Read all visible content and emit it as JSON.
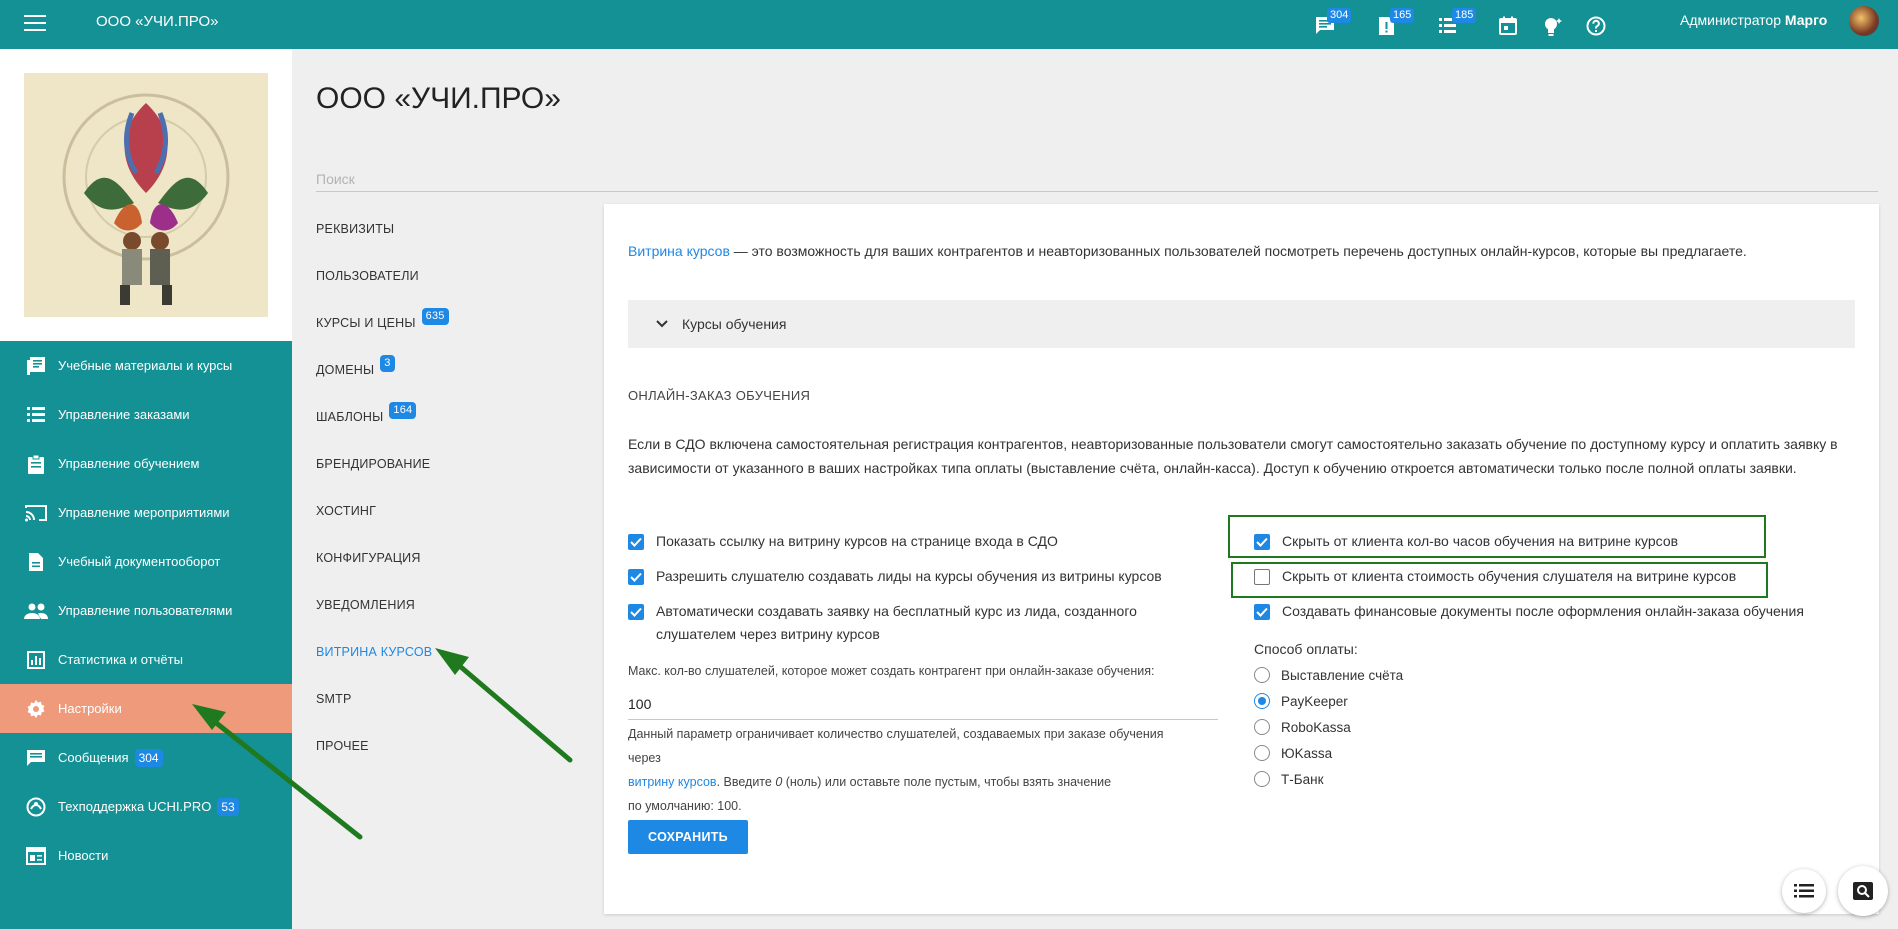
{
  "topbar": {
    "brand": "ООО «УЧИ.ПРО»",
    "badges": {
      "messages": "304",
      "docs": "165",
      "list": "185"
    },
    "admin_prefix": "Администратор",
    "admin_name": "Марго"
  },
  "sidebar": {
    "items": [
      {
        "label": "Учебные материалы и курсы",
        "icon": "book-icon"
      },
      {
        "label": "Управление заказами",
        "icon": "list-icon"
      },
      {
        "label": "Управление обучением",
        "icon": "clipboard-icon"
      },
      {
        "label": "Управление мероприятиями",
        "icon": "cast-icon"
      },
      {
        "label": "Учебный документооборот",
        "icon": "document-icon"
      },
      {
        "label": "Управление пользователями",
        "icon": "people-icon"
      },
      {
        "label": "Статистика и отчёты",
        "icon": "chart-icon"
      },
      {
        "label": "Настройки",
        "icon": "gear-icon"
      },
      {
        "label": "Сообщения",
        "icon": "message-icon",
        "badge": "304"
      },
      {
        "label": "Техподдержка UCHI.PRO",
        "icon": "support-icon",
        "badge": "53"
      },
      {
        "label": "Новости",
        "icon": "news-icon"
      }
    ],
    "active_index": 7
  },
  "page": {
    "title": "ООО «УЧИ.ПРО»",
    "search_placeholder": "Поиск"
  },
  "subnav": {
    "items": [
      {
        "label": "РЕКВИЗИТЫ"
      },
      {
        "label": "ПОЛЬЗОВАТЕЛИ"
      },
      {
        "label": "КУРСЫ И ЦЕНЫ",
        "badge": "635"
      },
      {
        "label": "ДОМЕНЫ",
        "badge": "3"
      },
      {
        "label": "ШАБЛОНЫ",
        "badge": "164"
      },
      {
        "label": "БРЕНДИРОВАНИЕ"
      },
      {
        "label": "ХОСТИНГ"
      },
      {
        "label": "КОНФИГУРАЦИЯ"
      },
      {
        "label": "УВЕДОМЛЕНИЯ"
      },
      {
        "label": "ВИТРИНА КУРСОВ"
      },
      {
        "label": "SMTP"
      },
      {
        "label": "ПРОЧЕЕ"
      }
    ],
    "active_index": 9
  },
  "card": {
    "intro_link": "Витрина курсов",
    "intro_text": " — это возможность для ваших контрагентов и неавторизованных пользователей посмотреть перечень доступных онлайн-курсов, которые вы предлагаете.",
    "accordion_label": "Курсы обучения",
    "section_heading": "ОНЛАЙН-ЗАКАЗ ОБУЧЕНИЯ",
    "description": "Если в СДО включена самостоятельная регистрация контрагентов, неавторизованные пользователи смогут самостоятельно заказать обучение по доступному курсу и оплатить заявку в зависимости от указанного в ваших настройках типа оплаты (выставление счёта, онлайн-касса). Доступ к обучению откроется автоматически только после полной оплаты заявки.",
    "left_checks": [
      {
        "label": "Показать ссылку на витрину курсов на странице входа в СДО",
        "checked": true
      },
      {
        "label": "Разрешить слушателю создавать лиды на курсы обучения из витрины курсов",
        "checked": true
      },
      {
        "label": "Автоматически создавать заявку на бесплатный курс из лида, созданного слушателем через витрину курсов",
        "checked": true
      }
    ],
    "right_checks": [
      {
        "label": "Скрыть от клиента кол-во часов обучения на витрине курсов",
        "checked": true
      },
      {
        "label": "Скрыть от клиента стоимость обучения слушателя на витрине курсов",
        "checked": false
      },
      {
        "label": "Создавать финансовые документы после оформления онлайн-заказа обучения",
        "checked": true
      }
    ],
    "max_label": "Макс. кол-во слушателей, которое может создать контрагент при онлайн-заказе обучения:",
    "max_value": "100",
    "hint_1": "Данный параметр ограничивает количество слушателей, создаваемых при заказе обучения через",
    "hint_link": "витрину курсов",
    "hint_2": ". Введите ",
    "hint_zero": "0",
    "hint_3": " (ноль) или оставьте поле пустым, чтобы взять значение",
    "hint_4": "по умолчанию: 100.",
    "payment_label": "Способ оплаты:",
    "payment_options": [
      {
        "label": "Выставление счёта",
        "selected": false
      },
      {
        "label": "PayKeeper",
        "selected": true
      },
      {
        "label": "RoboKassa",
        "selected": false
      },
      {
        "label": "ЮKassa",
        "selected": false
      },
      {
        "label": "Т-Банк",
        "selected": false
      }
    ],
    "save_label": "СОХРАНИТЬ"
  },
  "colors": {
    "teal": "#149195",
    "accent": "#1e88e5",
    "active_nav": "#ef9a7a",
    "highlight": "#1f7a1f"
  }
}
